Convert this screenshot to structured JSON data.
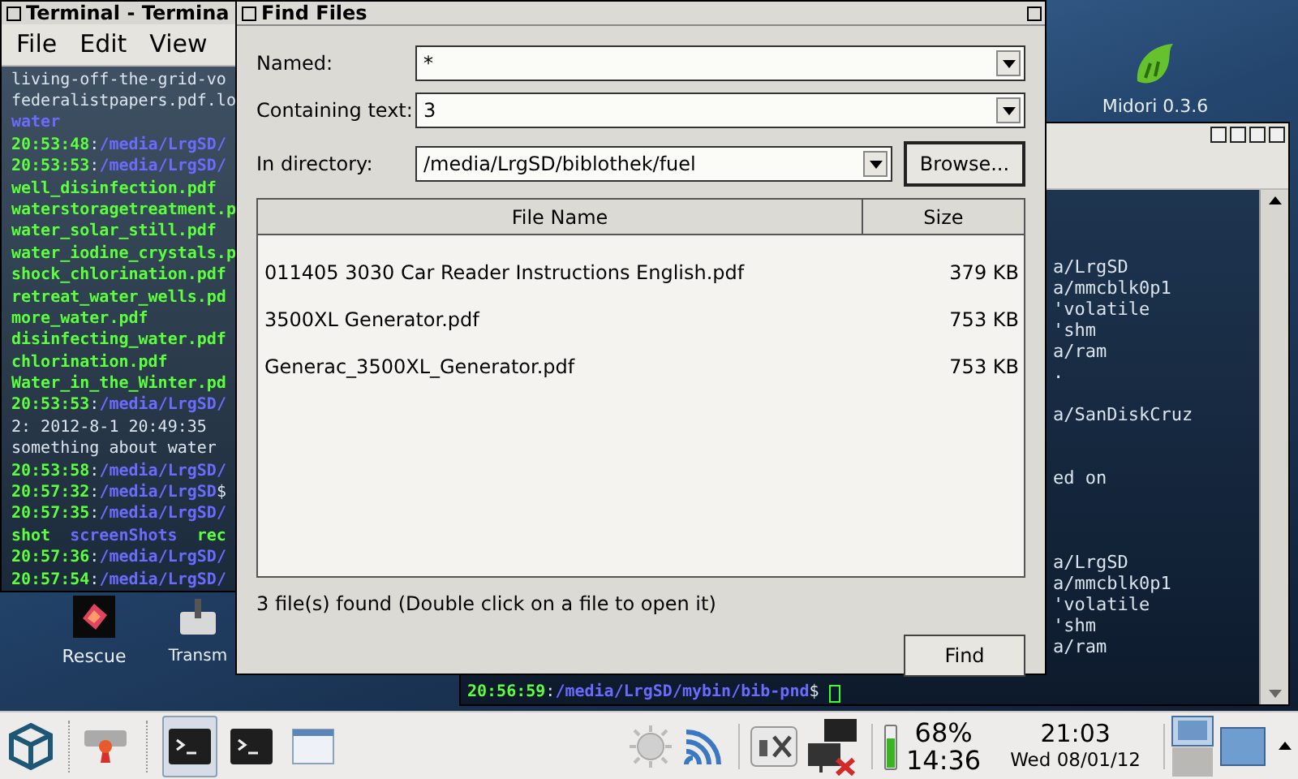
{
  "desktop": {
    "icons": [
      {
        "kind": "rescue",
        "label": "Rescue"
      },
      {
        "kind": "transmission",
        "label": "Transm"
      },
      {
        "kind": "midori",
        "label": "Midori 0.3.6"
      }
    ]
  },
  "terminal_left": {
    "title": "Terminal - Termina",
    "menu": [
      "File",
      "Edit",
      "View"
    ],
    "lines": [
      [
        {
          "kind": "plain",
          "text": "living-off-the-grid-vo"
        }
      ],
      [
        {
          "kind": "plain",
          "text": "federalistpapers.pdf.lo"
        }
      ],
      [
        {
          "kind": "dir",
          "text": "water"
        }
      ],
      [
        {
          "kind": "time",
          "text": "20:53:48"
        },
        {
          "kind": "plain",
          "text": ":"
        },
        {
          "kind": "dir",
          "text": "/media/LrgSD/"
        }
      ],
      [
        {
          "kind": "time",
          "text": "20:53:53"
        },
        {
          "kind": "plain",
          "text": ":"
        },
        {
          "kind": "dir",
          "text": "/media/LrgSD/"
        }
      ],
      [
        {
          "kind": "file",
          "text": "well_disinfection.pdf"
        }
      ],
      [
        {
          "kind": "file",
          "text": "waterstoragetreatment.p"
        }
      ],
      [
        {
          "kind": "file",
          "text": "water_solar_still.pdf"
        }
      ],
      [
        {
          "kind": "file",
          "text": "water_iodine_crystals.p"
        }
      ],
      [
        {
          "kind": "file",
          "text": "shock_chlorination.pdf"
        }
      ],
      [
        {
          "kind": "file",
          "text": "retreat_water_wells.pd"
        }
      ],
      [
        {
          "kind": "file",
          "text": "more_water.pdf"
        }
      ],
      [
        {
          "kind": "file",
          "text": "disinfecting_water.pdf"
        }
      ],
      [
        {
          "kind": "file",
          "text": "chlorination.pdf"
        }
      ],
      [
        {
          "kind": "file",
          "text": "Water_in_the_Winter.pd"
        }
      ],
      [
        {
          "kind": "time",
          "text": "20:53:53"
        },
        {
          "kind": "plain",
          "text": ":"
        },
        {
          "kind": "dir",
          "text": "/media/LrgSD/"
        }
      ],
      [
        {
          "kind": "plain",
          "text": "2: 2012-8-1 20:49:35"
        }
      ],
      [
        {
          "kind": "plain",
          "text": "something about water"
        }
      ],
      [
        {
          "kind": "time",
          "text": "20:53:58"
        },
        {
          "kind": "plain",
          "text": ":"
        },
        {
          "kind": "dir",
          "text": "/media/LrgSD/"
        }
      ],
      [
        {
          "kind": "time",
          "text": "20:57:32"
        },
        {
          "kind": "plain",
          "text": ":"
        },
        {
          "kind": "dir",
          "text": "/media/LrgSD"
        },
        {
          "kind": "plain",
          "text": "$"
        }
      ],
      [
        {
          "kind": "time",
          "text": "20:57:35"
        },
        {
          "kind": "plain",
          "text": ":"
        },
        {
          "kind": "dir",
          "text": "/media/LrgSD/"
        }
      ],
      [
        {
          "kind": "file",
          "text": "shot"
        },
        {
          "kind": "dir",
          "text": "screenShots"
        },
        {
          "kind": "file",
          "text": "rec"
        }
      ],
      [
        {
          "kind": "time",
          "text": "20:57:36"
        },
        {
          "kind": "plain",
          "text": ":"
        },
        {
          "kind": "dir",
          "text": "/media/LrgSD/"
        }
      ],
      [
        {
          "kind": "time",
          "text": "20:57:54"
        },
        {
          "kind": "plain",
          "text": ":"
        },
        {
          "kind": "dir",
          "text": "/media/LrgSD/"
        }
      ]
    ]
  },
  "terminal_right": {
    "lines": [
      {
        "kind": "blank"
      },
      {
        "kind": "blank"
      },
      {
        "kind": "blank"
      },
      {
        "kind": "text",
        "text": "a/LrgSD"
      },
      {
        "kind": "text",
        "text": "a/mmcblk0p1"
      },
      {
        "kind": "text",
        "text": "'volatile"
      },
      {
        "kind": "text",
        "text": "'shm"
      },
      {
        "kind": "text",
        "text": "a/ram"
      },
      {
        "kind": "text",
        "text": "."
      },
      {
        "kind": "blank"
      },
      {
        "kind": "text",
        "text": "a/SanDiskCruz"
      },
      {
        "kind": "blank"
      },
      {
        "kind": "blank"
      },
      {
        "kind": "text",
        "text": "ed on"
      },
      {
        "kind": "blank"
      },
      {
        "kind": "blank"
      },
      {
        "kind": "blank"
      },
      {
        "kind": "text",
        "text": "a/LrgSD"
      },
      {
        "kind": "text",
        "text": "a/mmcblk0p1"
      },
      {
        "kind": "text",
        "text": "'volatile"
      },
      {
        "kind": "text",
        "text": "'shm"
      },
      {
        "kind": "text",
        "text": "a/ram"
      }
    ],
    "prompt": [
      {
        "kind": "time",
        "text": "20:56:59"
      },
      {
        "kind": "plain",
        "text": ":"
      },
      {
        "kind": "dir",
        "text": "/media/LrgSD/mybin/bib-pnd"
      },
      {
        "kind": "plain",
        "text": "$"
      }
    ]
  },
  "find_dialog": {
    "title": "Find Files",
    "fields": [
      {
        "label": "Named:",
        "value": "*",
        "kind": "combo"
      },
      {
        "label": "Containing text:",
        "value": "3",
        "kind": "combo"
      },
      {
        "label": "In directory:",
        "value": "/media/LrgSD/biblothek/fuel",
        "kind": "combo_browse",
        "button": "Browse..."
      }
    ],
    "table": {
      "columns": [
        "File Name",
        "Size"
      ],
      "rows": [
        [
          "011405 3030 Car Reader Instructions English.pdf",
          "379 KB"
        ],
        [
          "3500XL Generator.pdf",
          "753 KB"
        ],
        [
          "Generac_3500XL_Generator.pdf",
          "753 KB"
        ]
      ]
    },
    "status": "3 file(s) found (Double click on a file to open it)",
    "find_button": "Find"
  },
  "taskbar": {
    "tasks": [
      {
        "kind": "terminal",
        "selected": true
      },
      {
        "kind": "terminal",
        "selected": false
      },
      {
        "kind": "window",
        "selected": false
      }
    ],
    "battery": "68%",
    "remaining": "14:36",
    "time": "21:03",
    "date": "Wed 08/01/12"
  }
}
